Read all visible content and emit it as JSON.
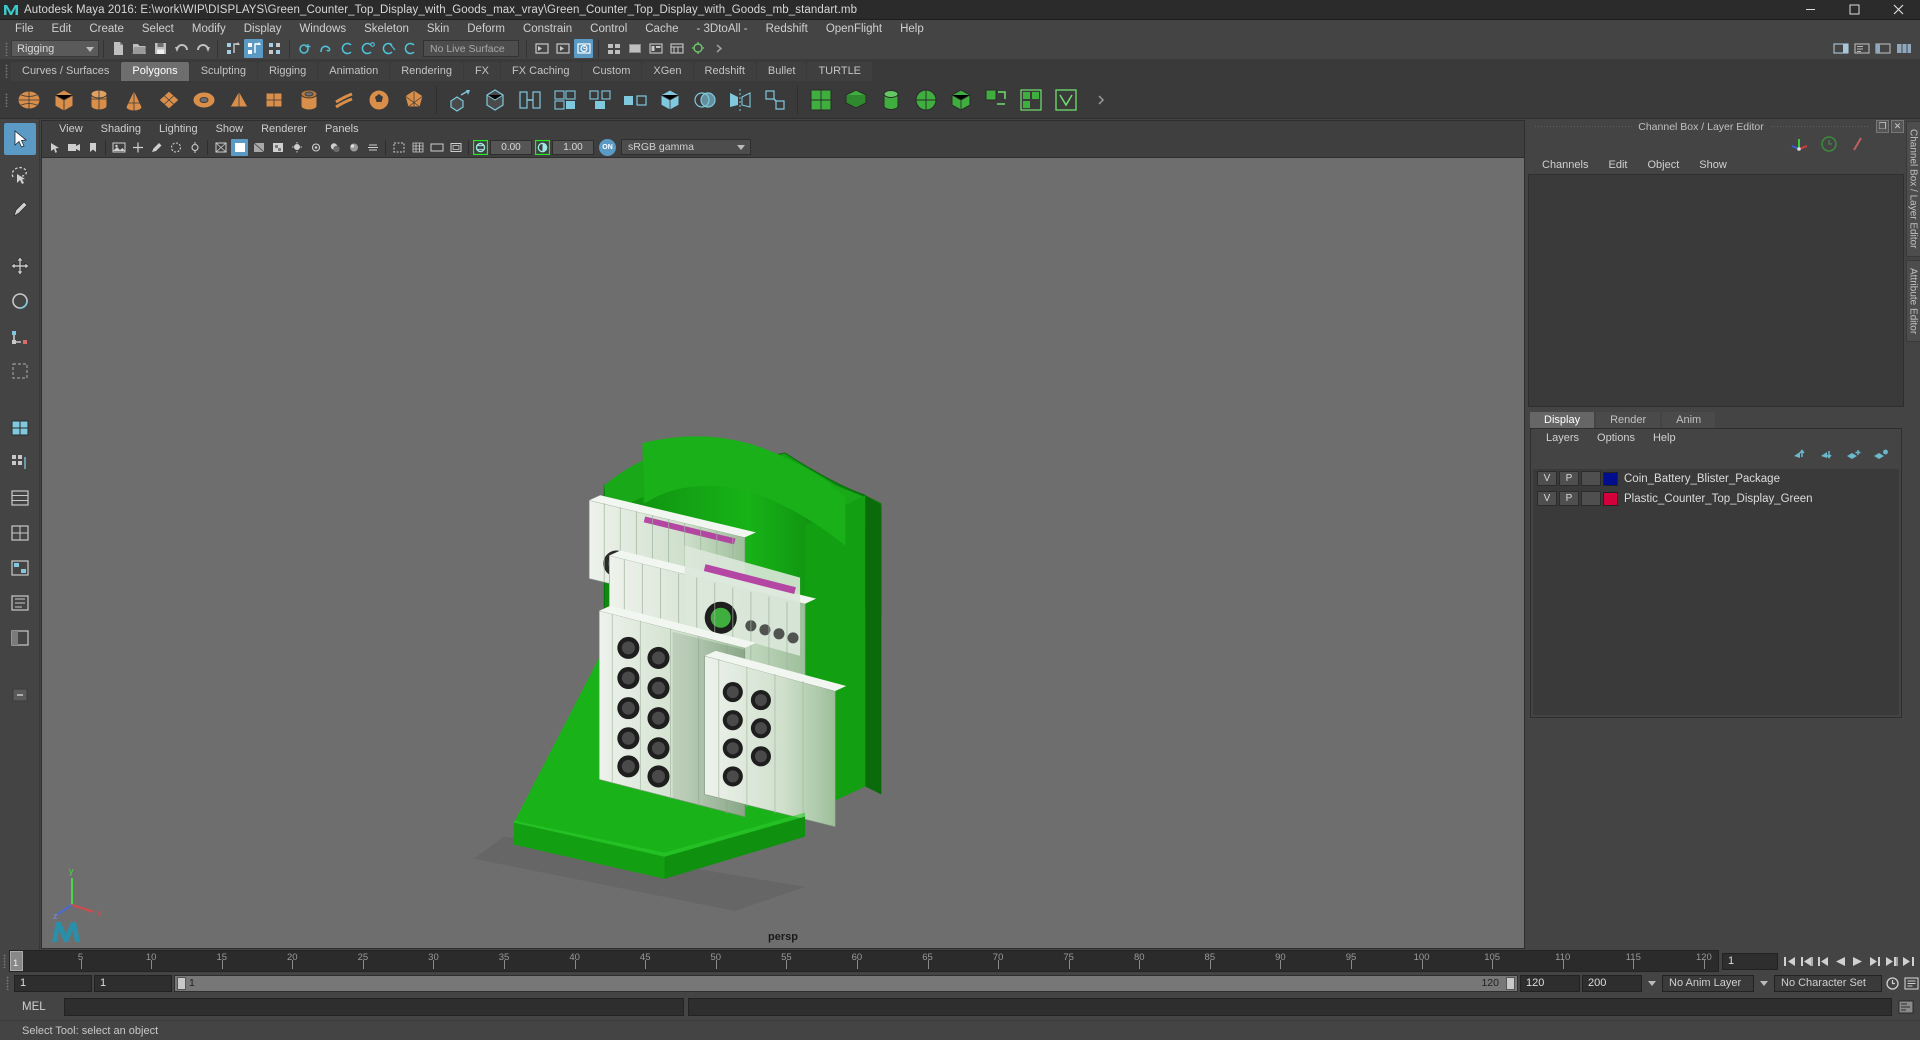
{
  "window": {
    "title": "Autodesk Maya 2016: E:\\work\\WIP\\DISPLAYS\\Green_Counter_Top_Display_with_Goods_max_vray\\Green_Counter_Top_Display_with_Goods_mb_standart.mb",
    "minimize": "—",
    "maximize": "❐",
    "close": "✕",
    "app_icon": "maya-icon"
  },
  "menubar": {
    "items": [
      "File",
      "Edit",
      "Create",
      "Select",
      "Modify",
      "Display",
      "Windows",
      "Skeleton",
      "Skin",
      "Deform",
      "Constrain",
      "Control",
      "Cache",
      "- 3DtoAll -",
      "Redshift",
      "OpenFlight",
      "Help"
    ]
  },
  "toolbar": {
    "menuset": "Rigging",
    "live_surface": "No Live Surface",
    "icons": [
      "new-scene-icon",
      "open-scene-icon",
      "save-scene-icon",
      "undo-icon",
      "redo-icon",
      "select-hierarchy-icon",
      "select-object-icon",
      "select-component-icon",
      "snap-grid-icon",
      "snap-curve-icon",
      "snap-point-icon",
      "snap-projected-icon",
      "snap-view-icon",
      "snap-pivot-icon",
      "render-current-icon",
      "ipr-render-icon",
      "render-settings-icon",
      "hypershade-icon",
      "render-view-icon"
    ],
    "right_icons": [
      "sidebar-toggle-icon",
      "attribute-editor-icon",
      "tool-settings-icon",
      "channel-box-icon"
    ]
  },
  "shelf": {
    "tabs": [
      "Curves / Surfaces",
      "Polygons",
      "Sculpting",
      "Rigging",
      "Animation",
      "Rendering",
      "FX",
      "FX Caching",
      "Custom",
      "XGen",
      "Redshift",
      "Bullet",
      "TURTLE"
    ],
    "active_tab": "Polygons",
    "item_count": 26
  },
  "toolbox": {
    "items": [
      {
        "name": "select-tool",
        "selected": true
      },
      {
        "name": "lasso-select-tool",
        "selected": false
      },
      {
        "name": "paint-select-tool",
        "selected": false
      },
      {
        "name": "move-tool",
        "selected": false
      },
      {
        "name": "rotate-tool",
        "selected": false
      },
      {
        "name": "scale-tool",
        "selected": false
      },
      {
        "name": "last-tool",
        "selected": false
      },
      {
        "name": "single-pane-layout",
        "selected": false
      },
      {
        "name": "two-pane-layout",
        "selected": false
      },
      {
        "name": "three-pane-layout",
        "selected": false
      },
      {
        "name": "four-pane-layout",
        "selected": false
      },
      {
        "name": "hypergraph-layout",
        "selected": false
      },
      {
        "name": "outliner-layout",
        "selected": false
      },
      {
        "name": "persp-outliner-layout",
        "selected": false
      }
    ]
  },
  "viewport": {
    "panel_menus": [
      "View",
      "Shading",
      "Lighting",
      "Show",
      "Renderer",
      "Panels"
    ],
    "camera_label": "persp",
    "exposure_value": "0.00",
    "gamma_value": "1.00",
    "color_management": "sRGB gamma",
    "color_mgmt_enabled": "ON",
    "axis_x": "x",
    "axis_y": "y",
    "axis_z": "z",
    "scene_description": "Green counter-top retail display stand with three rows of blister-packaged coin batteries"
  },
  "channel_box": {
    "panel_title": "Channel Box / Layer Editor",
    "menus": [
      "Channels",
      "Edit",
      "Object",
      "Show"
    ],
    "float_btn": "❐",
    "close_btn": "✕"
  },
  "layer_editor": {
    "tabs": [
      "Display",
      "Render",
      "Anim"
    ],
    "active_tab": "Display",
    "menus": [
      "Layers",
      "Options",
      "Help"
    ],
    "toolbar_icons": [
      "move-layer-up-icon",
      "move-layer-down-icon",
      "new-layer-icon",
      "new-layer-from-selected-icon"
    ],
    "layers": [
      {
        "visibility": "V",
        "playback": "P",
        "type": "",
        "color": "#000d8c",
        "name": "Coin_Battery_Blister_Package"
      },
      {
        "visibility": "V",
        "playback": "P",
        "type": "",
        "color": "#d4003c",
        "name": "Plastic_Counter_Top_Display_Green"
      }
    ]
  },
  "side_tabs": [
    "Channel Box / Layer Editor",
    "Attribute Editor"
  ],
  "timeline": {
    "ticks": [
      5,
      10,
      15,
      20,
      25,
      30,
      35,
      40,
      45,
      50,
      55,
      60,
      65,
      70,
      75,
      80,
      85,
      90,
      95,
      100,
      105,
      110,
      115,
      120
    ],
    "current_frame": "1",
    "current_frame_field": "1",
    "range_start": "1",
    "range_end": "1",
    "playback_start": "1",
    "playback_end": "120",
    "anim_end": "120",
    "scene_end": "200",
    "anim_layer": "No Anim Layer",
    "character_set": "No Character Set",
    "playback_buttons": [
      "go-to-start-icon",
      "step-back-key-icon",
      "step-back-frame-icon",
      "play-backwards-icon",
      "play-forwards-icon",
      "step-forward-frame-icon",
      "step-forward-key-icon",
      "go-to-end-icon"
    ],
    "auto_key_icon": "auto-keyframe-icon",
    "anim_prefs_icon": "animation-preferences-icon"
  },
  "command_line": {
    "mel_label": "MEL",
    "input_value": "",
    "output_value": "",
    "help_icon": "script-editor-icon"
  },
  "status_bar": {
    "message": "Select Tool: select an object"
  },
  "colors": {
    "accent": "#5b9ac4",
    "shelf_icon": "#d98f4a",
    "viewport_bg": "#6e6e6e",
    "display_green": "#18a818"
  }
}
